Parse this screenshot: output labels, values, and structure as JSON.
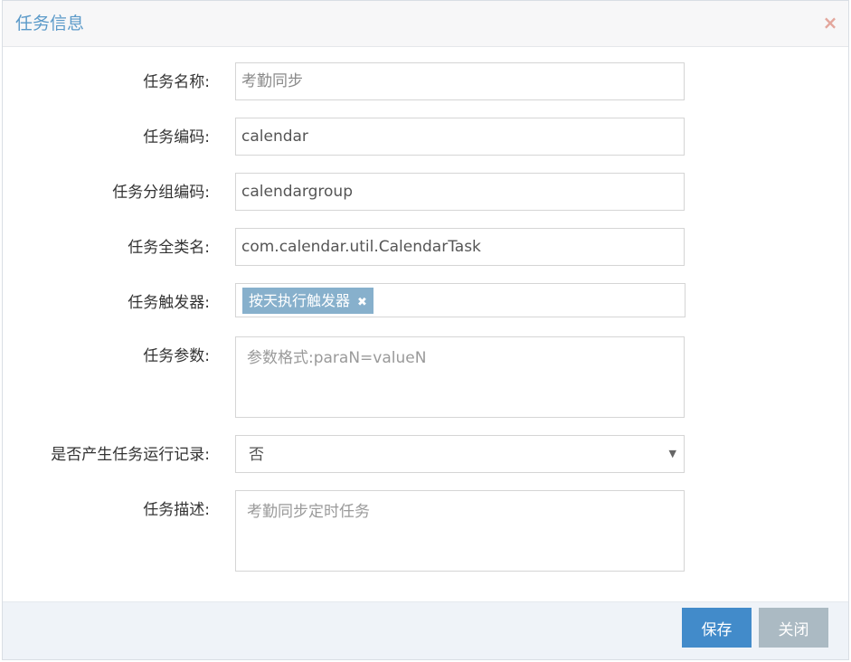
{
  "dialog": {
    "title": "任务信息",
    "close_symbol": "×"
  },
  "form": {
    "task_name": {
      "label": "任务名称:",
      "placeholder": "考勤同步"
    },
    "task_code": {
      "label": "任务编码:",
      "value": "calendar"
    },
    "task_group_code": {
      "label": "任务分组编码:",
      "value": "calendargroup"
    },
    "task_class": {
      "label": "任务全类名:",
      "value": "com.calendar.util.CalendarTask"
    },
    "task_trigger": {
      "label": "任务触发器:",
      "tag": "按天执行触发器",
      "tag_remove_symbol": "✖"
    },
    "task_params": {
      "label": "任务参数:",
      "placeholder": "参数格式:paraN=valueN"
    },
    "gen_log": {
      "label": "是否产生任务运行记录:",
      "selected": "否",
      "arrow": "▼"
    },
    "task_desc": {
      "label": "任务描述:",
      "placeholder": "考勤同步定时任务"
    }
  },
  "footer": {
    "save_label": "保存",
    "close_label": "关闭"
  },
  "colors": {
    "title": "#5b9ac9",
    "save_button": "#428bca",
    "close_button": "#abbac3",
    "tag": "#87b0cc"
  }
}
